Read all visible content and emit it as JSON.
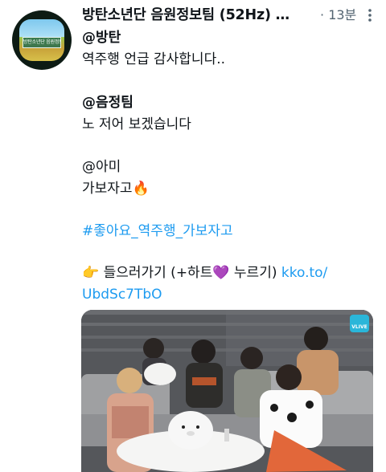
{
  "tweet": {
    "avatar_sign_text": "방탄소년단 음원정보팀",
    "display_name": "방탄소년단 음원정보팀 (52Hz) …",
    "time_separator": "·",
    "timestamp": "13분",
    "more_icon": "more-options-icon",
    "lines": [
      "@방탄",
      "역주행 언급 감사합니다..",
      "@음정팀",
      "노 저어 보겠습니다",
      "@아미",
      "가보자고",
      "#좋아요_역주행_가보자고",
      "들으러가기 (+하트",
      "누르기)",
      "kko.to/",
      "UbdSc7TbO"
    ],
    "emoji": {
      "fire": "🔥",
      "pointing_hand": "👉",
      "purple_heart": "💜"
    },
    "media": {
      "vlive_badge": "VLIVE",
      "description": ""
    }
  },
  "colors": {
    "link": "#1d9bf0",
    "text": "#0f1419",
    "muted": "#536471"
  }
}
